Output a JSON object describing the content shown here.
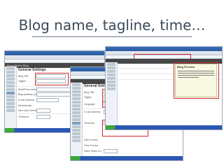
{
  "slide": {
    "title": "Blog name, tagline, time…"
  },
  "screens": {
    "back": {
      "blog_name": "Bloomfield's Blog",
      "page_heading": "General Settings",
      "field_labels": [
        "Blog Title",
        "Tagline",
        "WordPress address (URL)",
        "Blog address (URL)",
        "E-mail address",
        "Membership",
        "New User Default Role",
        "Timezone"
      ]
    },
    "middle": {
      "page_heading": "General Settings",
      "field_labels": [
        "Blog Title",
        "Tagline",
        "Language",
        "E-mail address",
        "Timezone",
        "Date Format",
        "Time Format",
        "Week Starts On"
      ]
    },
    "front": {
      "note_heading": "Blog Preview"
    }
  },
  "colors": {
    "highlight": "#d22a2a",
    "wp_admin_bar": "#464646",
    "browser_title": "#2a5aa0",
    "taskbar": "#2b57b4"
  }
}
